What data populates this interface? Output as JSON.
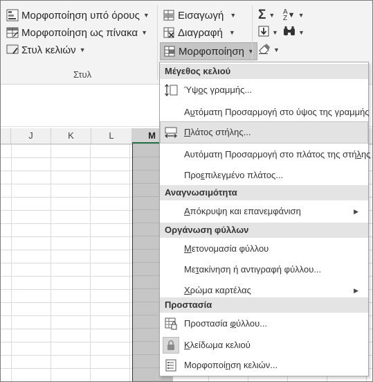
{
  "ribbon": {
    "styles_group": {
      "conditional_formatting": "Μορφοποίηση υπό όρους",
      "format_as_table": "Μορφοποίηση ως πίνακα",
      "cell_styles": "Στυλ κελιών",
      "label": "Στυλ"
    },
    "cells_group": {
      "insert": "Εισαγωγή",
      "delete": "Διαγραφή",
      "format": "Μορφοποίηση"
    },
    "editing_group": {
      "autosum_icon": "sigma-icon",
      "sort_icon": "sort-filter-icon",
      "fill_icon": "fill-down-icon",
      "find_icon": "binoculars-icon",
      "clear_icon": "eraser-icon"
    }
  },
  "sheet": {
    "columns": [
      "J",
      "K",
      "L",
      "M"
    ],
    "selected_column": "M"
  },
  "menu": {
    "sections": [
      {
        "header": "Μέγεθος κελιού",
        "items": [
          {
            "pre": "Ύψ",
            "key": "ο",
            "post": "ς γραμμής...",
            "icon": "row-height-icon"
          },
          {
            "pre": "Α",
            "key": "υ",
            "post": "τόματη Προσαρμογή στο ύψος της γραμμής"
          },
          {
            "pre": "",
            "key": "Π",
            "post": "λάτος στήλης...",
            "icon": "column-width-icon"
          },
          {
            "pre": "Αυτόματη Προσαρμογή στο πλάτος της στή",
            "key": "λ",
            "post": "ης"
          },
          {
            "pre": "Προ",
            "key": "ε",
            "post": "πιλεγμένο πλάτος..."
          }
        ]
      },
      {
        "header": "Αναγνωσιμότητα",
        "items": [
          {
            "pre": "",
            "key": "Α",
            "post": "πόκρυψη και επανεμφάνιση"
          }
        ]
      },
      {
        "header": "Οργάνωση φύλλων",
        "items": [
          {
            "pre": "",
            "key": "Μ",
            "post": "ετονομασία φύλλου"
          },
          {
            "pre": "Με",
            "key": "τ",
            "post": "ακίνηση ή αντιγραφή φύλλου..."
          },
          {
            "pre": "",
            "key": "Χ",
            "post": "ρώμα καρτέλας"
          }
        ]
      },
      {
        "header": "Προστασία",
        "items": [
          {
            "pre": "Προστασία ",
            "key": "φ",
            "post": "ύλλου...",
            "icon": "protect-sheet-icon"
          },
          {
            "pre": "",
            "key": "Κ",
            "post": "λείδωμα κελιού",
            "icon": "lock-icon"
          },
          {
            "pre": "Μορφοποί",
            "key": "η",
            "post": "ση κελιών...",
            "icon": "format-cells-icon"
          }
        ]
      }
    ]
  }
}
